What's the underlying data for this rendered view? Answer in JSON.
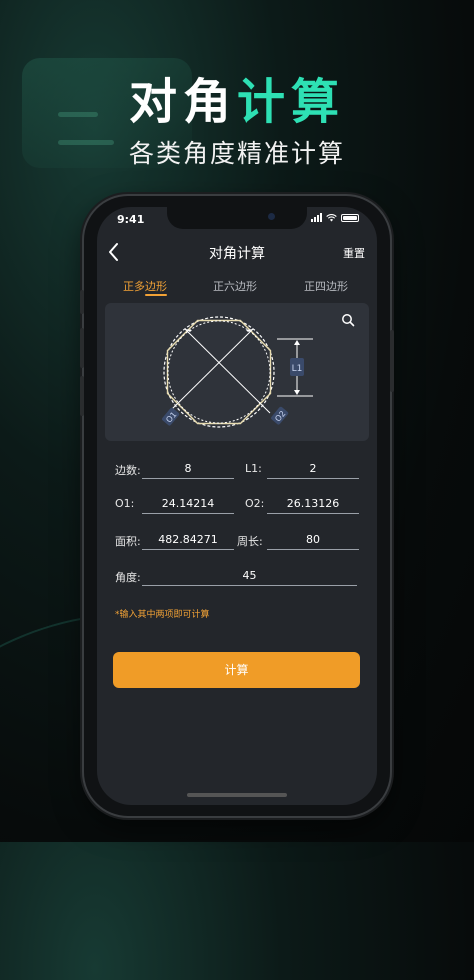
{
  "hero": {
    "title_part1": "对角",
    "title_part2": "计算",
    "subtitle": "各类角度精准计算"
  },
  "status_bar": {
    "time": "9:41"
  },
  "navbar": {
    "back_icon": "chevron-left-icon",
    "title": "对角计算",
    "reset_label": "重置"
  },
  "tabs": [
    {
      "label": "正多边形",
      "active": true
    },
    {
      "label": "正六边形",
      "active": false
    },
    {
      "label": "正四边形",
      "active": false
    }
  ],
  "diagram": {
    "label_l1": "L1",
    "label_o1": "O1",
    "label_o2": "O2",
    "zoom_icon": "search-icon"
  },
  "form": {
    "sides_label": "边数:",
    "sides_value": "8",
    "l1_label": "L1:",
    "l1_value": "2",
    "o1_label": "O1:",
    "o1_value": "24.14214",
    "o2_label": "O2:",
    "o2_value": "26.13126",
    "area_label": "面积:",
    "area_value": "482.84271",
    "perimeter_label": "周长:",
    "perimeter_value": "80",
    "angle_label": "角度:",
    "angle_value": "45"
  },
  "hint": "*输入其中两项即可计算",
  "calc_button": "计算",
  "colors": {
    "accent_orange": "#f09c27",
    "accent_teal": "#2ee0b4",
    "screen_bg": "#23262b",
    "panel_bg": "#2f333a"
  }
}
